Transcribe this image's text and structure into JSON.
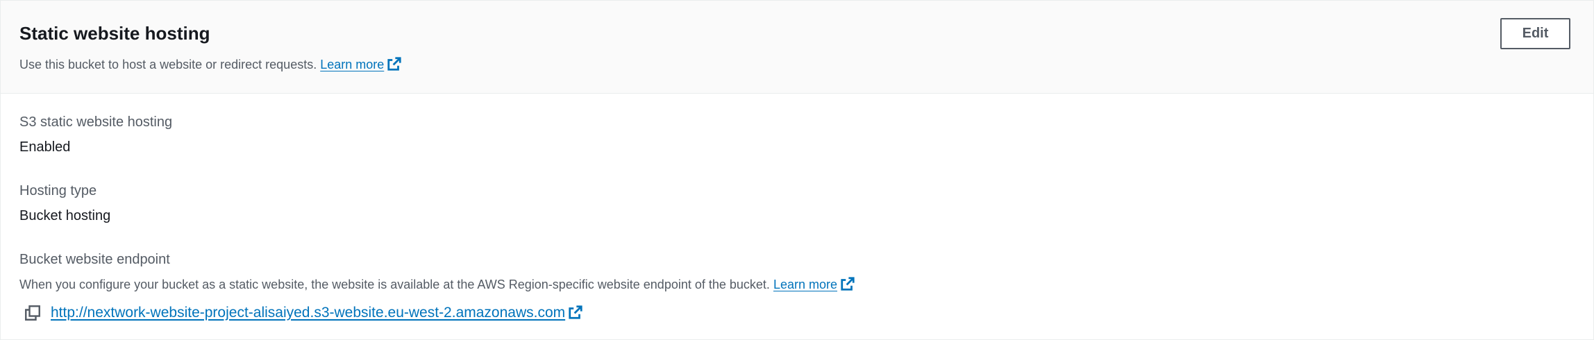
{
  "header": {
    "title": "Static website hosting",
    "description": "Use this bucket to host a website or redirect requests.",
    "learn_more": "Learn more",
    "edit_label": "Edit"
  },
  "fields": {
    "hosting_label": "S3 static website hosting",
    "hosting_value": "Enabled",
    "type_label": "Hosting type",
    "type_value": "Bucket hosting",
    "endpoint_label": "Bucket website endpoint",
    "endpoint_description": "When you configure your bucket as a static website, the website is available at the AWS Region-specific website endpoint of the bucket.",
    "endpoint_learn_more": "Learn more",
    "endpoint_url": "http://nextwork-website-project-alisaiyed.s3-website.eu-west-2.amazonaws.com"
  },
  "icons": {
    "external": "external-link-icon",
    "copy": "copy-icon"
  },
  "colors": {
    "link": "#0073bb",
    "header_bg": "#fafafa",
    "text": "#16191f",
    "secondary_text": "#545b64"
  }
}
